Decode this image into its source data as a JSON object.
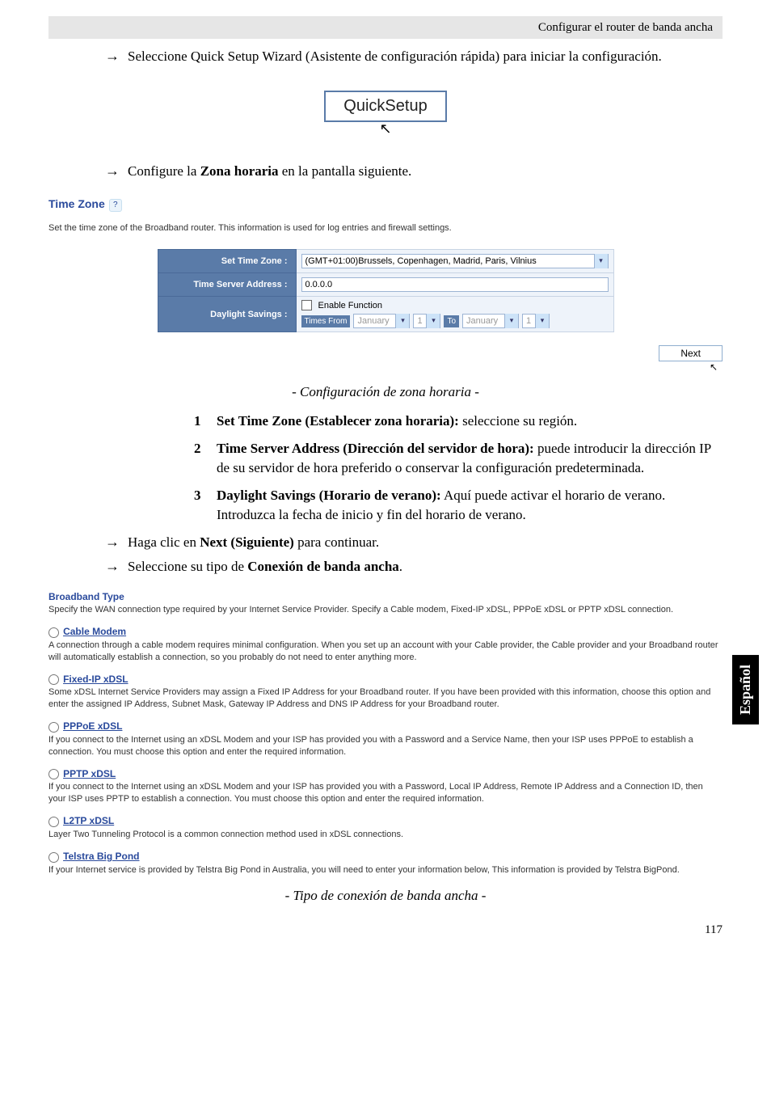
{
  "header": {
    "title": "Configurar el router de banda ancha"
  },
  "steps": {
    "step1": "Seleccione Quick Setup Wizard (Asistente de configuración rápida) para iniciar la configuración.",
    "quicksetup_label": "QuickSetup",
    "step2_pre": "Configure la ",
    "step2_bold": "Zona horaria",
    "step2_post": " en la pantalla siguiente."
  },
  "timezone_panel": {
    "title": "Time Zone",
    "desc": "Set the time zone of the Broadband router. This information is used for log entries and firewall settings.",
    "rows": {
      "set_tz_label": "Set Time Zone :",
      "set_tz_value": "(GMT+01:00)Brussels, Copenhagen, Madrid, Paris, Vilnius",
      "server_label": "Time Server Address :",
      "server_value": "0.0.0.0",
      "ds_label": "Daylight Savings :",
      "ds_enable": "Enable Function",
      "ds_times_from": "Times From",
      "ds_to": "To",
      "ds_month": "January",
      "ds_day": "1"
    },
    "next_label": "Next"
  },
  "caption1": "- Configuración de zona horaria -",
  "list": {
    "i1_bold": "Set Time Zone (Establecer zona horaria):",
    "i1_txt": " seleccione su región.",
    "i2_bold": "Time Server Address (Dirección del servidor de hora):",
    "i2_txt": " puede introducir la dirección IP de su servidor de hora preferido o conservar la configuración predeterminada.",
    "i3_bold": "Daylight Savings (Horario de verano):",
    "i3_txt": " Aquí puede activar el horario de verano. Introduzca la fecha de inicio y fin del horario de verano."
  },
  "steps2": {
    "s1_pre": "Haga clic en ",
    "s1_bold": "Next (Siguiente)",
    "s1_post": " para continuar.",
    "s2_pre": "Seleccione su tipo de ",
    "s2_bold": "Conexión de banda ancha",
    "s2_post": "."
  },
  "broadband": {
    "title": "Broadband Type",
    "desc": "Specify the WAN connection type required by your Internet Service Provider. Specify a Cable modem, Fixed-IP xDSL, PPPoE xDSL or PPTP xDSL connection.",
    "options": [
      {
        "name": " Cable Modem",
        "desc": "A connection through a cable modem requires minimal configuration. When you set up an account with your Cable provider, the Cable provider and your Broadband router will automatically establish a connection, so you probably do not need to enter anything more."
      },
      {
        "name": " Fixed-IP xDSL",
        "desc": "Some xDSL Internet Service Providers may assign a Fixed IP Address for your Broadband router. If you have been provided with this information, choose this option and enter the assigned IP Address, Subnet Mask, Gateway IP Address and DNS IP Address for your Broadband router."
      },
      {
        "name": " PPPoE xDSL",
        "desc": "If you connect to the Internet using an xDSL Modem and your ISP has provided you with a Password and a Service Name, then your ISP uses PPPoE to establish a connection. You must choose this option and enter the required information."
      },
      {
        "name": " PPTP xDSL",
        "desc": "If you connect to the Internet using an xDSL Modem and your ISP has provided you with a Password, Local IP Address, Remote IP Address and a Connection ID, then your ISP uses PPTP to establish a connection. You must choose this option and enter the required information."
      },
      {
        "name": " L2TP xDSL",
        "desc": "Layer Two Tunneling Protocol is a common connection method used in xDSL connections."
      },
      {
        "name": " Telstra Big Pond",
        "desc": "If your Internet service is provided by Telstra Big Pond in Australia, you will need to enter your information below, This information is provided by Telstra BigPond."
      }
    ]
  },
  "caption2": "- Tipo de conexión de banda ancha -",
  "side_tab": "Español",
  "page_number": "117"
}
